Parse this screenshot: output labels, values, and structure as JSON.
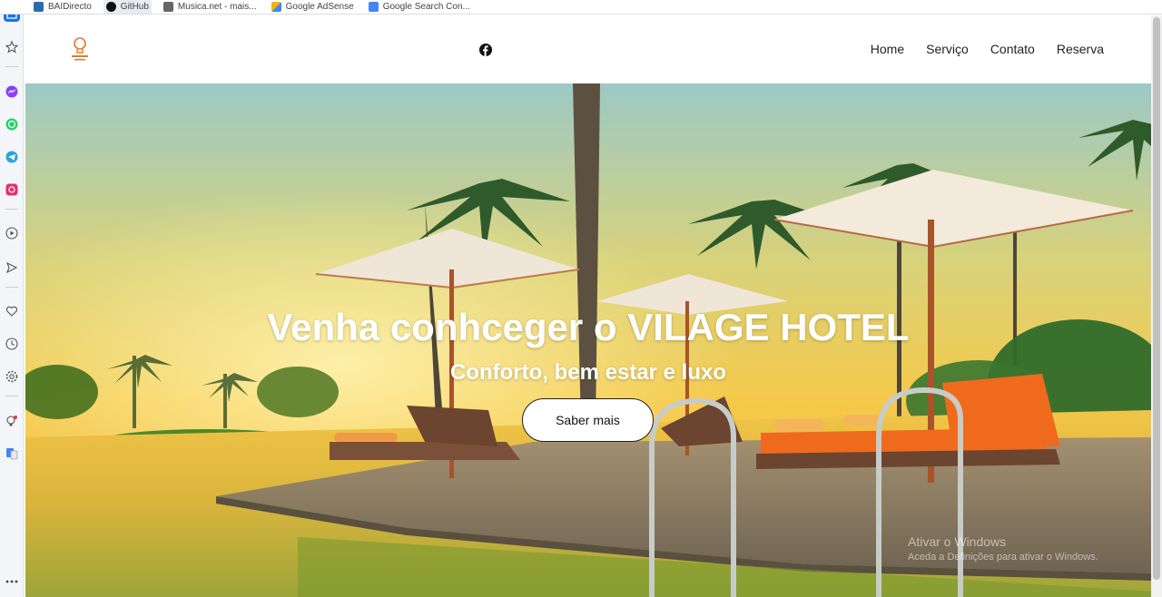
{
  "browser": {
    "bookmarks": [
      {
        "label": "BAIDirecto",
        "icon": "bai-icon",
        "color": "#2b6cb0"
      },
      {
        "label": "GitHub",
        "icon": "github-icon",
        "color": "#111111"
      },
      {
        "label": "Musica.net - mais...",
        "icon": "page-icon",
        "color": "#555555"
      },
      {
        "label": "Google AdSense",
        "icon": "adsense-icon",
        "color": "#f4b400"
      },
      {
        "label": "Google Search Con...",
        "icon": "search-console-icon",
        "color": "#4285f4"
      }
    ],
    "sidebar_icons": [
      "home-icon",
      "star-icon",
      "messenger-icon",
      "whatsapp-icon",
      "telegram-icon",
      "instagram-icon",
      "player-icon",
      "send-icon",
      "heart-icon",
      "history-icon",
      "settings-icon",
      "bulb-icon",
      "translate-icon",
      "more-icon"
    ]
  },
  "site": {
    "nav": {
      "logo_icon": "lightbulb-logo-icon",
      "social_icon": "facebook-icon",
      "menu": [
        "Home",
        "Serviço",
        "Contato",
        "Reserva"
      ]
    },
    "hero": {
      "title": "Venha conhceger o VILAGE HOTEL",
      "subtitle": "Conforto, bem estar e luxo",
      "button": "Saber mais"
    },
    "watermark": {
      "line1": "Ativar o Windows",
      "line2": "Aceda a Definições para ativar o Windows."
    }
  },
  "colors": {
    "brand_orange": "#e8782a",
    "sky_top": "#8fc7c9",
    "sky_sunset": "#f3c64a",
    "deck": "#8c7a62",
    "lounger_cushion": "#f06a1d"
  }
}
